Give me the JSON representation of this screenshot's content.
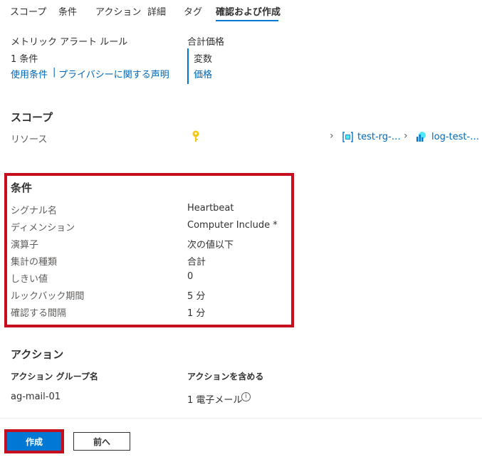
{
  "tabs": [
    "スコープ",
    "条件",
    "アクション",
    "詳細",
    "タグ",
    "確認および作成"
  ],
  "active_tab": "確認および作成",
  "summary": {
    "rule_type": "メトリック アラート ルール",
    "condition_count": "1 条件",
    "terms_link": "使用条件",
    "separator": "|",
    "privacy_link": "プライバシーに関する声明",
    "total_price_label": "合計価格",
    "price_variable": "変数",
    "price_link": "価格"
  },
  "scope": {
    "heading": "スコープ",
    "resource_label": "リソース",
    "breadcrumb": [
      "test-rg-…",
      "log-test-…"
    ],
    "icons": [
      "key-icon",
      "resource-group-icon",
      "log-analytics-icon"
    ]
  },
  "condition": {
    "heading": "条件",
    "rows": [
      {
        "label": "シグナル名",
        "value": "Heartbeat"
      },
      {
        "label": "ディメンション",
        "value": "Computer Include *"
      },
      {
        "label": "演算子",
        "value": "次の値以下"
      },
      {
        "label": "集計の種類",
        "value": "合計"
      },
      {
        "label": "しきい値",
        "value": "0"
      },
      {
        "label": "ルックバック期間",
        "value": "5 分"
      },
      {
        "label": "確認する間隔",
        "value": "1 分"
      }
    ]
  },
  "actions": {
    "heading": "アクション",
    "col_group": "アクション グループ名",
    "col_include": "アクションを含める",
    "group_name": "ag-mail-01",
    "include_value": "1 電子メール",
    "info_glyph": "i"
  },
  "footer": {
    "create_label": "作成",
    "back_label": "前へ"
  },
  "colors": {
    "accent": "#0078d4",
    "link": "#0067b8",
    "highlight": "#c50f1f",
    "key": "#f2c811"
  }
}
